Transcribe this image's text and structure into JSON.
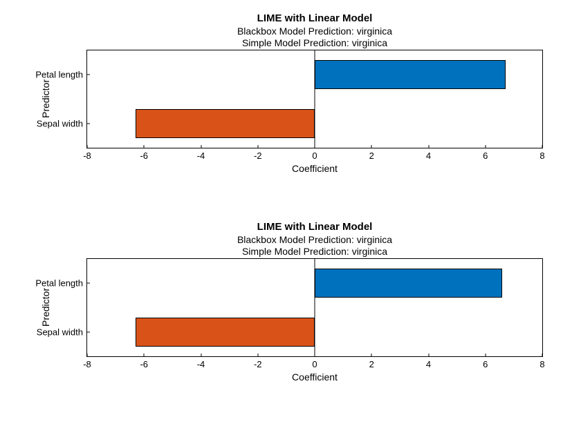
{
  "chart_data": [
    {
      "type": "bar",
      "orientation": "horizontal",
      "title": "LIME with Linear Model",
      "subtitle1": "Blackbox Model Prediction: virginica",
      "subtitle2": "Simple Model Prediction: virginica",
      "xlabel": "Coefficient",
      "ylabel": "Predictor",
      "xlim": [
        -8,
        8
      ],
      "xticks": [
        -8,
        -6,
        -4,
        -2,
        0,
        2,
        4,
        6,
        8
      ],
      "categories": [
        "Petal length",
        "Sepal width"
      ],
      "values": [
        6.7,
        -6.3
      ],
      "colors": [
        "#0072BD",
        "#D95319"
      ]
    },
    {
      "type": "bar",
      "orientation": "horizontal",
      "title": "LIME with Linear Model",
      "subtitle1": "Blackbox Model Prediction: virginica",
      "subtitle2": "Simple Model Prediction: virginica",
      "xlabel": "Coefficient",
      "ylabel": "Predictor",
      "xlim": [
        -8,
        8
      ],
      "xticks": [
        -8,
        -6,
        -4,
        -2,
        0,
        2,
        4,
        6,
        8
      ],
      "categories": [
        "Petal length",
        "Sepal width"
      ],
      "values": [
        6.6,
        -6.3
      ],
      "colors": [
        "#0072BD",
        "#D95319"
      ]
    }
  ]
}
